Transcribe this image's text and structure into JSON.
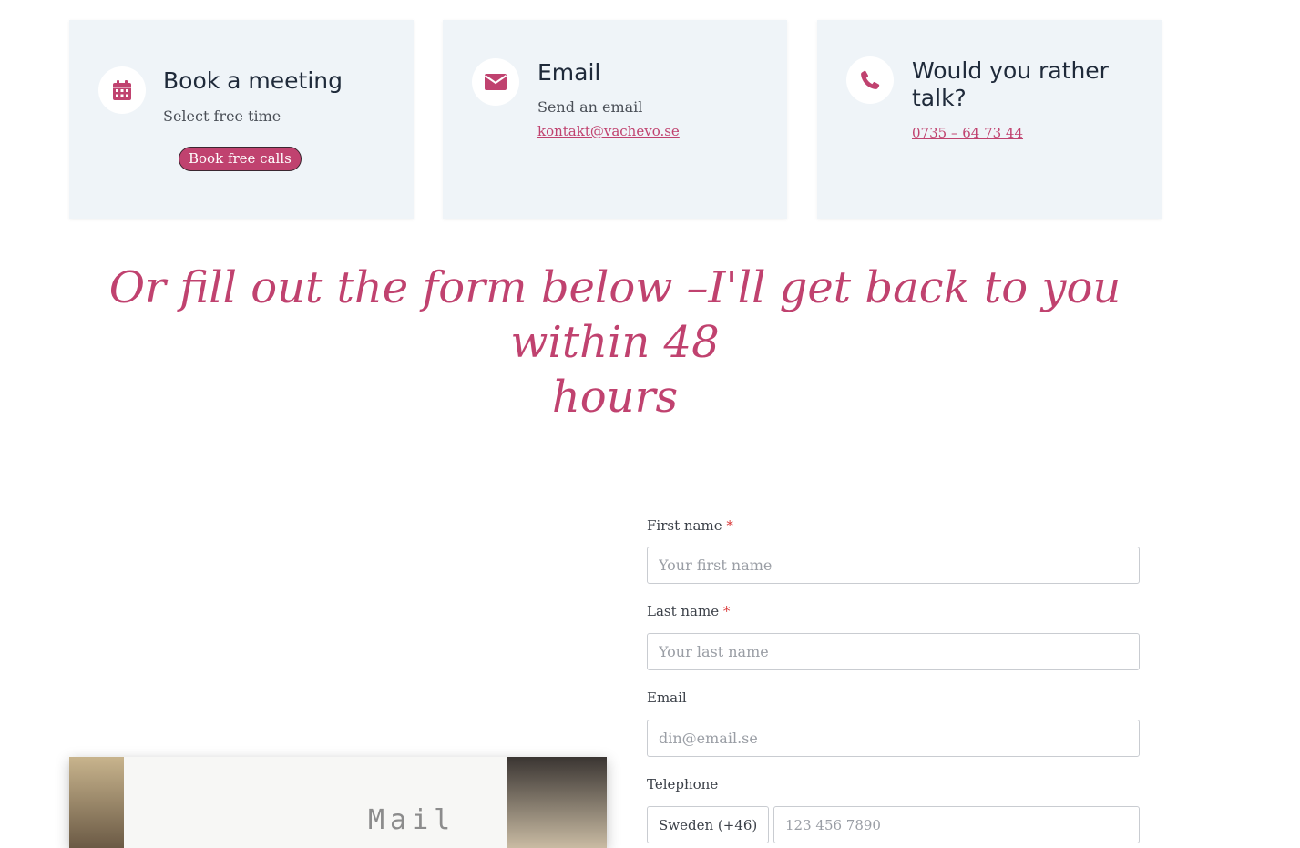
{
  "colors": {
    "accent": "#c0426f",
    "card_background": "#eff4f8",
    "title_text": "#1f2a3a"
  },
  "cards": [
    {
      "icon": "calendar-icon",
      "title": "Book a meeting",
      "text": "Select free time",
      "button_label": "Book free calls"
    },
    {
      "icon": "envelope-icon",
      "title": "Email",
      "text": "Send an email",
      "link": "kontakt@vachevo.se"
    },
    {
      "icon": "phone-icon",
      "title_line1": "Would you rather",
      "title_line2": "talk?",
      "link": "0735 – 64 73 44"
    }
  ],
  "heading": {
    "line1": "Or fill out the form below –I'll get back to you within 48",
    "line2": "hours"
  },
  "form": {
    "first_name": {
      "label": "First name",
      "required_mark": "*",
      "placeholder": "Your first name",
      "value": ""
    },
    "last_name": {
      "label": "Last name",
      "required_mark": "*",
      "placeholder": "Your last name",
      "value": ""
    },
    "email": {
      "label": "Email",
      "placeholder": "din@email.se",
      "value": ""
    },
    "telephone": {
      "label": "Telephone",
      "country_selected": "Sweden (+46)",
      "placeholder": "123 456 7890"
    }
  },
  "photo": {
    "typed_text": "Mail"
  }
}
